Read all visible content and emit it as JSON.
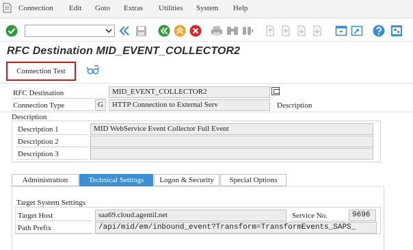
{
  "menu": {
    "items": [
      "Connection",
      "Edit",
      "Goto",
      "Extras",
      "Utilities",
      "System",
      "Help"
    ]
  },
  "page": {
    "title": "RFC Destination MID_EVENT_COLLECTOR2"
  },
  "app_toolbar": {
    "connection_test_label": "Connection Test"
  },
  "header_fields": {
    "rfc_destination_label": "RFC Destination",
    "rfc_destination_value": "MID_EVENT_COLLECTOR2",
    "connection_type_label": "Connection Type",
    "connection_type_code": "G",
    "connection_type_text": "HTTP Connection to External Serv",
    "description_label": "Description"
  },
  "description_group": {
    "title": "Description",
    "rows": [
      {
        "label": "Description 1",
        "value": "MID WebService Event Collector Full Event"
      },
      {
        "label": "Description 2",
        "value": ""
      },
      {
        "label": "Description 3",
        "value": ""
      }
    ]
  },
  "tabs": [
    {
      "label": "Administration",
      "active": false
    },
    {
      "label": "Technical Settings",
      "active": true
    },
    {
      "label": "Logon & Security",
      "active": false
    },
    {
      "label": "Special Options",
      "active": false
    }
  ],
  "target_system": {
    "title": "Target System Settings",
    "target_host_label": "Target Host",
    "target_host_value": "saa69.cloud.agentil.net",
    "service_no_label": "Service No.",
    "service_no_value": "9696",
    "path_prefix_label": "Path Prefix",
    "path_prefix_value": "/api/mid/em/inbound_event?Transform=TransformEvents_SAPS_"
  },
  "colors": {
    "accent_blue": "#3b8fd1",
    "highlight_red": "#c11b23",
    "check_green": "#2e9a3e",
    "cancel_red": "#d9262e",
    "warning_orange": "#f3a21f"
  }
}
